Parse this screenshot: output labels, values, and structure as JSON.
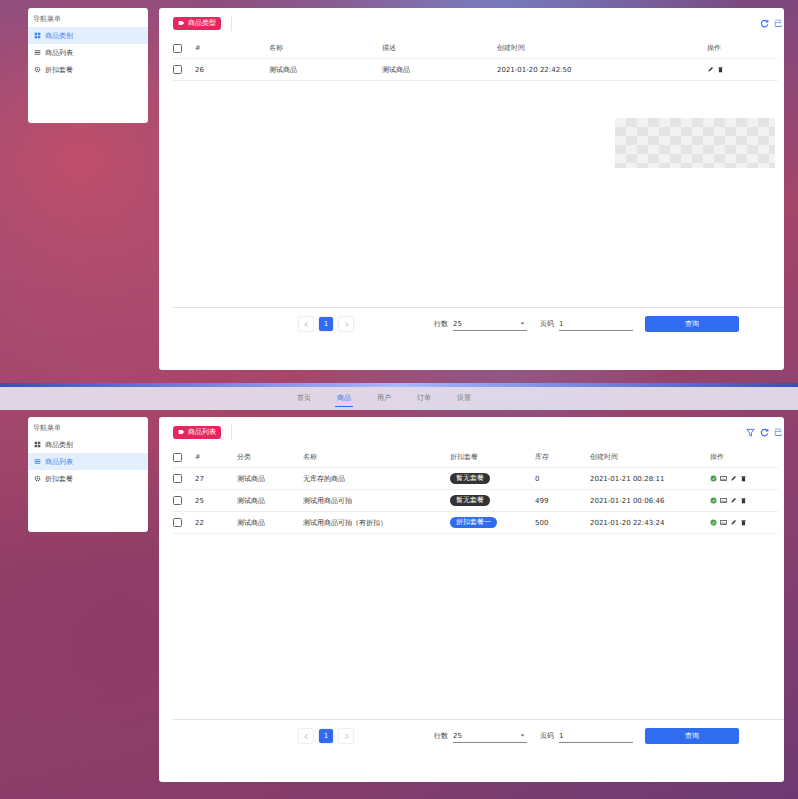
{
  "views": [
    {
      "kind": "category",
      "nav": [],
      "sidebar": {
        "title": "导航菜单",
        "items": [
          {
            "label": "商品类别",
            "selected": true
          },
          {
            "label": "商品列表",
            "selected": false
          },
          {
            "label": "折扣套餐",
            "selected": false
          }
        ]
      },
      "tag": "商品类型",
      "toolbar_text": "已",
      "table": {
        "all_checked": false,
        "columns": [
          {
            "label": "#",
            "kind": "text"
          },
          {
            "label": "名称",
            "kind": "text"
          },
          {
            "label": "描述",
            "kind": "text"
          },
          {
            "label": "创建时间",
            "kind": "text"
          },
          {
            "label": "操作",
            "kind": "actions"
          }
        ],
        "rows": [
          {
            "checked": false,
            "cells": [
              "26",
              "测试商品",
              "测试商品",
              "2021-01-20 22:42:50",
              ""
            ]
          }
        ]
      },
      "pagination": {
        "pages": [
          {
            "label": "1",
            "selected": true
          }
        ],
        "rows_label": "行数",
        "rows_value": "25",
        "page_label": "页码",
        "page_value": "1",
        "button": "查询"
      }
    },
    {
      "kind": "product",
      "nav": [
        {
          "label": "首页",
          "selected": false
        },
        {
          "label": "商品",
          "selected": true
        },
        {
          "label": "用户",
          "selected": false
        },
        {
          "label": "订单",
          "selected": false
        },
        {
          "label": "设置",
          "selected": false
        }
      ],
      "sidebar": {
        "title": "导航菜单",
        "items": [
          {
            "label": "商品类别",
            "selected": false
          },
          {
            "label": "商品列表",
            "selected": true
          },
          {
            "label": "折扣套餐",
            "selected": false
          }
        ]
      },
      "tag": "商品列表",
      "toolbar_text": "已",
      "table": {
        "all_checked": false,
        "columns": [
          {
            "label": "#",
            "kind": "text"
          },
          {
            "label": "分类",
            "kind": "text"
          },
          {
            "label": "名称",
            "kind": "text"
          },
          {
            "label": "折扣套餐",
            "kind": "chip"
          },
          {
            "label": "库存",
            "kind": "text"
          },
          {
            "label": "创建时间",
            "kind": "text"
          },
          {
            "label": "操作",
            "kind": "actions"
          }
        ],
        "rows": [
          {
            "checked": false,
            "cells": [
              "27",
              "测试商品",
              "无库存的商品",
              {
                "label": "暂无套餐",
                "color": "#333333"
              },
              "0",
              "2021-01-21 00:28:11",
              ""
            ]
          },
          {
            "checked": false,
            "cells": [
              "25",
              "测试商品",
              "测试用商品可拍",
              {
                "label": "暂无套餐",
                "color": "#333333"
              },
              "499",
              "2021-01-21 00:06:46",
              ""
            ]
          },
          {
            "checked": false,
            "cells": [
              "22",
              "测试商品",
              "测试用商品可拍（有折扣）",
              {
                "label": "折扣套餐一",
                "color": "#2f6cf0"
              },
              "500",
              "2021-01-20 22:43:24",
              ""
            ]
          }
        ]
      },
      "pagination": {
        "pages": [
          {
            "label": "1",
            "selected": true
          }
        ],
        "rows_label": "行数",
        "rows_value": "25",
        "page_label": "页码",
        "page_value": "1",
        "button": "查询"
      }
    }
  ]
}
